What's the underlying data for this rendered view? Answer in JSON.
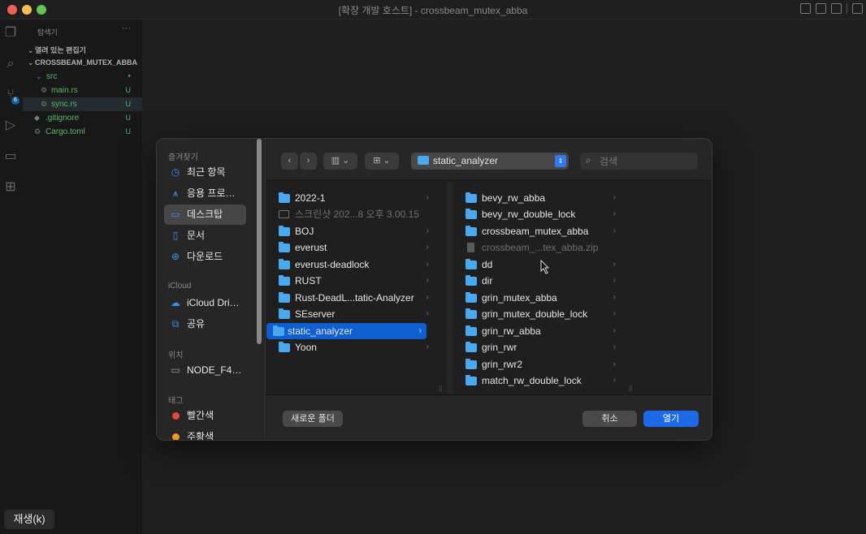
{
  "window": {
    "title": "[확장 개발 호스트] - crossbeam_mutex_abba"
  },
  "explorer": {
    "title": "탐색기",
    "more": "···",
    "open_editors": "열려 있는 편집기",
    "project": "CROSSBEAM_MUTEX_ABBA",
    "tree": [
      {
        "label": "src",
        "status": "●"
      },
      {
        "label": "main.rs",
        "status": "U"
      },
      {
        "label": "sync.rs",
        "status": "U"
      },
      {
        "label": ".gitignore",
        "status": "U"
      },
      {
        "label": "Cargo.toml",
        "status": "U"
      }
    ],
    "scm_badge": "6"
  },
  "dialog": {
    "sidebar": {
      "favorites_header": "즐겨찾기",
      "favorites": [
        "최근 항목",
        "응용 프로…",
        "데스크탑",
        "문서",
        "다운로드"
      ],
      "icloud_header": "iCloud",
      "icloud": [
        "iCloud Dri…",
        "공유"
      ],
      "locations_header": "위치",
      "locations": [
        "NODE_F4…"
      ],
      "tags_header": "태그",
      "tags": [
        {
          "label": "빨간색",
          "color": "#e5473d"
        },
        {
          "label": "주황색",
          "color": "#f0962e"
        }
      ]
    },
    "toolbar": {
      "back": "‹",
      "forward": "›",
      "view_mode": "▥ ⌄",
      "group_mode": "⊞ ⌄",
      "path": "static_analyzer",
      "search_placeholder": "검색"
    },
    "column1": [
      {
        "label": "2022-1",
        "type": "folder"
      },
      {
        "label": "스크린샷 202...8 오후 3.00.15",
        "type": "image"
      },
      {
        "label": "BOJ",
        "type": "folder"
      },
      {
        "label": "everust",
        "type": "folder"
      },
      {
        "label": "everust-deadlock",
        "type": "folder"
      },
      {
        "label": "RUST",
        "type": "folder"
      },
      {
        "label": "Rust-DeadL...tatic-Analyzer",
        "type": "folder"
      },
      {
        "label": "SEserver",
        "type": "folder"
      },
      {
        "label": "static_analyzer",
        "type": "folder"
      },
      {
        "label": "Yoon",
        "type": "folder"
      }
    ],
    "column2": [
      {
        "label": "bevy_rw_abba",
        "type": "folder"
      },
      {
        "label": "bevy_rw_double_lock",
        "type": "folder"
      },
      {
        "label": "crossbeam_mutex_abba",
        "type": "folder"
      },
      {
        "label": "crossbeam_...tex_abba.zip",
        "type": "archive"
      },
      {
        "label": "dd",
        "type": "folder"
      },
      {
        "label": "dir",
        "type": "folder"
      },
      {
        "label": "grin_mutex_abba",
        "type": "folder"
      },
      {
        "label": "grin_mutex_double_lock",
        "type": "folder"
      },
      {
        "label": "grin_rw_abba",
        "type": "folder"
      },
      {
        "label": "grin_rwr",
        "type": "folder"
      },
      {
        "label": "grin_rwr2",
        "type": "folder"
      },
      {
        "label": "match_rw_double_lock",
        "type": "folder"
      }
    ],
    "footer": {
      "new_folder": "새로운 폴더",
      "cancel": "취소",
      "open": "열기"
    }
  },
  "overlay": {
    "replay": "재생(k)"
  }
}
